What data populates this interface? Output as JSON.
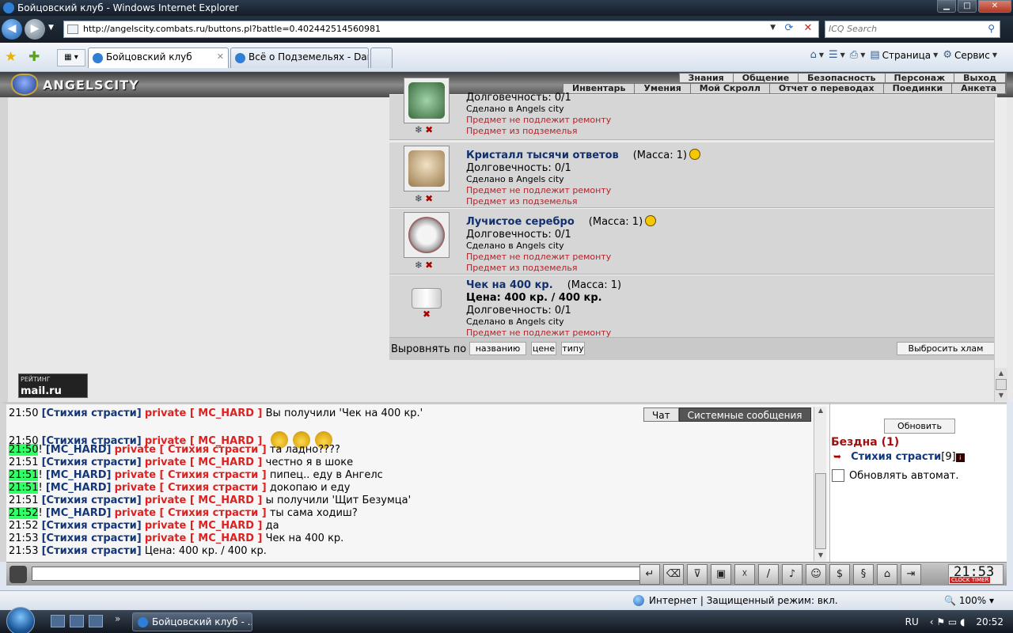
{
  "window": {
    "title": "Бойцовский клуб - Windows Internet Explorer",
    "minimize": "▁",
    "maximize": "□",
    "close": "✕"
  },
  "address": {
    "url": "http://angelscity.combats.ru/buttons.pl?battle=0.402442514560981",
    "search_placeholder": "ICQ Search"
  },
  "tabs": [
    {
      "label": "Бойцовский клуб"
    },
    {
      "label": "Всё о Подземельях - Dark..."
    }
  ],
  "commandbar": {
    "page_label": "Страница",
    "tools_label": "Сервис"
  },
  "site": {
    "logo_text": "ANGELSCITY",
    "menu_top": [
      "Знания",
      "Общение",
      "Безопасность",
      "Персонаж",
      "Выход"
    ],
    "menu_bottom": [
      "Инвентарь",
      "Умения",
      "Мой Скролл",
      "Отчет о переводах",
      "Поединки",
      "Анкета"
    ]
  },
  "inventory": {
    "partial_item": {
      "dur": "Долговечность: 0/1",
      "made": "Сделано в Angels city",
      "norepair": "Предмет не подлежит ремонту",
      "source": "Предмет из подземелья"
    },
    "items": [
      {
        "name": "Кристалл тысячи ответов",
        "mass": "(Масса: 1)",
        "dur": "Долговечность: 0/1",
        "made": "Сделано в Angels city",
        "norepair": "Предмет не подлежит ремонту",
        "source": "Предмет из подземелья"
      },
      {
        "name": "Лучистое серебро",
        "mass": "(Масса: 1)",
        "dur": "Долговечность: 0/1",
        "made": "Сделано в Angels city",
        "norepair": "Предмет не подлежит ремонту",
        "source": "Предмет из подземелья"
      },
      {
        "name": "Чек на 400 кр.",
        "mass": "(Масса: 1)",
        "price": "Цена: 400 кр. / 400 кр.",
        "dur": "Долговечность: 0/1",
        "made": "Сделано в Angels city",
        "norepair": "Предмет не подлежит ремонту"
      }
    ],
    "sort_label": "Выровнять по",
    "sort_buttons": [
      "названию",
      "цене",
      "типу"
    ],
    "trash_button": "Выбросить хлам"
  },
  "rating_widget": {
    "line1": "РЕЙТИНГ",
    "brand": "mail.ru"
  },
  "chat": {
    "tabs": [
      "Чат",
      "Системные сообщения"
    ],
    "lines": [
      {
        "time": "21:50",
        "hl": false,
        "bang": "",
        "name": "[Стихия страсти]",
        "priv": "private [ MC_HARD ]",
        "text": "Вы получили 'Чек на 400 кр.'"
      },
      {
        "time": "21:50",
        "hl": false,
        "bang": "",
        "name": "[Стихия страсти]",
        "priv": "private [ MC_HARD ]",
        "text": ""
      },
      {
        "time": "21:50",
        "hl": true,
        "bang": "!",
        "name": "[MC_HARD]",
        "priv": "private [ Стихия страсти ]",
        "text": "та ладно????"
      },
      {
        "time": "21:51",
        "hl": false,
        "bang": "",
        "name": "[Стихия страсти]",
        "priv": "private [ MC_HARD ]",
        "text": "честно я в шоке"
      },
      {
        "time": "21:51",
        "hl": true,
        "bang": "!",
        "name": "[MC_HARD]",
        "priv": "private [ Стихия страсти ]",
        "text": "пипец.. еду в Ангелс"
      },
      {
        "time": "21:51",
        "hl": true,
        "bang": "!",
        "name": "[MC_HARD]",
        "priv": "private [ Стихия страсти ]",
        "text": "докопаю и еду"
      },
      {
        "time": "21:51",
        "hl": false,
        "bang": "",
        "name": "[Стихия страсти]",
        "priv": "private [ MC_HARD ]",
        "text": "ы получили 'Щит Безумца'"
      },
      {
        "time": "21:52",
        "hl": true,
        "bang": "!",
        "name": "[MC_HARD]",
        "priv": "private [ Стихия страсти ]",
        "text": "ты сама ходиш?"
      },
      {
        "time": "21:52",
        "hl": false,
        "bang": "",
        "name": "[Стихия страсти]",
        "priv": "private [ MC_HARD ]",
        "text": "да"
      },
      {
        "time": "21:53",
        "hl": false,
        "bang": "",
        "name": "[Стихия страсти]",
        "priv": "private [ MC_HARD ]",
        "text": "Чек на 400 кр."
      },
      {
        "time": "21:53",
        "hl": false,
        "bang": "",
        "name": "[Стихия страсти]",
        "priv": "",
        "text": "Цена: 400 кр. / 400 кр."
      }
    ]
  },
  "room": {
    "refresh_button": "Обновить",
    "location": "Бездна (1)",
    "user_name": "Стихия страсти",
    "user_level": "[9]",
    "auto_label": "Обновлять автомат."
  },
  "clock": {
    "time": "21:53",
    "label": "CLOCK TIMER"
  },
  "statusbar": {
    "zone": "Интернет | Защищенный режим: вкл.",
    "zoom": "100%"
  },
  "taskbar": {
    "task_label": "Бойцовский клуб - ...",
    "lang": "RU",
    "time": "20:52"
  }
}
